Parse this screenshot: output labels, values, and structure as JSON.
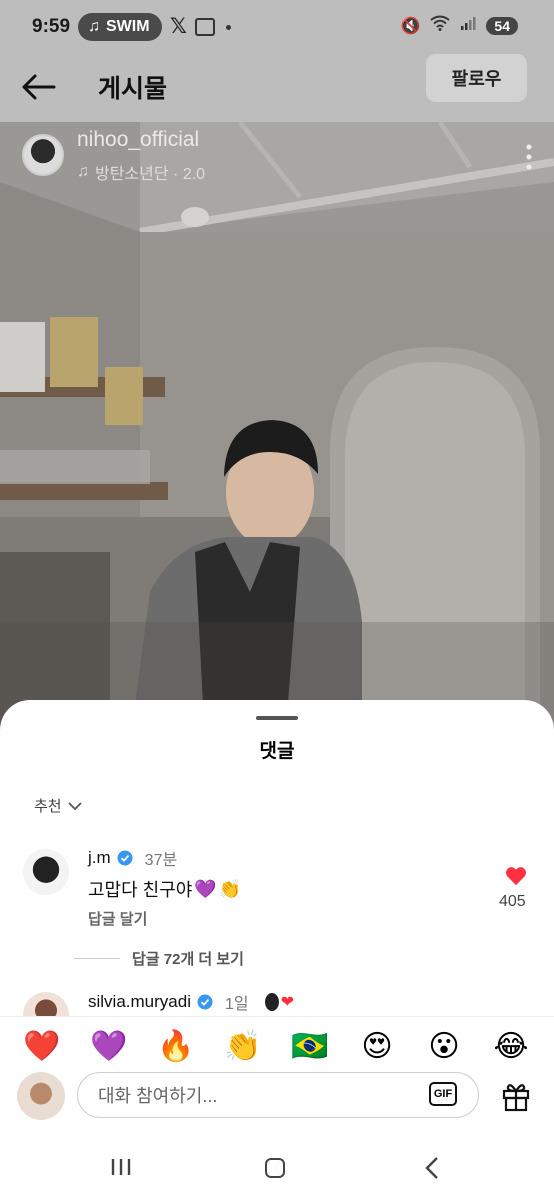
{
  "status_bar": {
    "time": "9:59",
    "music_pill": "SWIM",
    "battery": "54"
  },
  "header": {
    "title": "게시물",
    "follow_label": "팔로우"
  },
  "post": {
    "username": "nihoo_official",
    "music_label": "방탄소년단 · 2.0"
  },
  "comments_sheet": {
    "title": "댓글",
    "sort_label": "추천",
    "comments": [
      {
        "username": "j.m",
        "time": "37분",
        "text": "고맙다 친구야",
        "reply_label": "답글 달기",
        "likes": "405",
        "more_replies": "답글 72개 더 보기"
      },
      {
        "username": "silvia.muryadi",
        "time": "1일"
      }
    ]
  },
  "emoji_bar": [
    "❤️",
    "💜",
    "🔥",
    "👏",
    "🇧🇷",
    "😍",
    "😮",
    "😂"
  ],
  "composer": {
    "placeholder": "대화 참여하기...",
    "gif_label": "GIF"
  },
  "colors": {
    "like_red": "#ff3040",
    "verified_blue": "#3897f0"
  }
}
